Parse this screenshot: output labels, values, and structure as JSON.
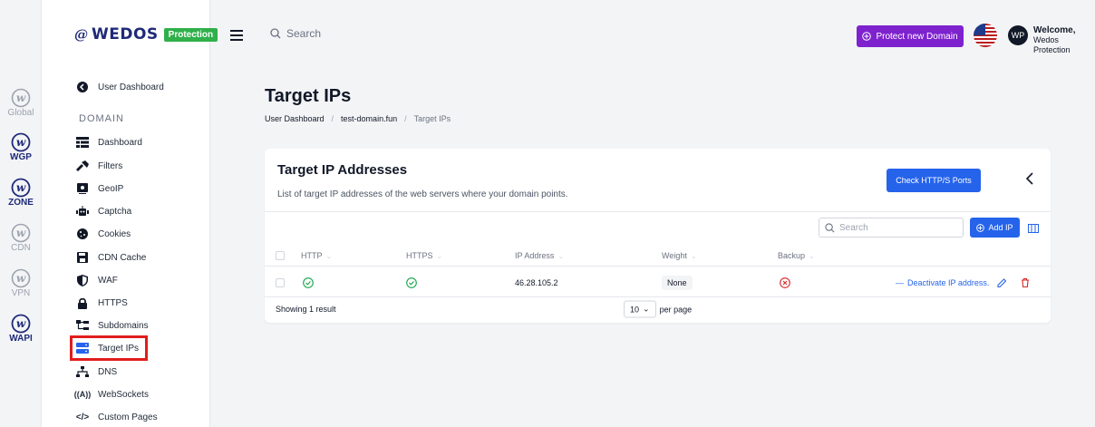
{
  "brand": {
    "mark": "@",
    "name": "WEDOS",
    "badge": "Protection"
  },
  "rail": [
    {
      "label": "Global",
      "state": "muted"
    },
    {
      "label": "WGP",
      "state": "active"
    },
    {
      "label": "ZONE",
      "state": "active"
    },
    {
      "label": "CDN",
      "state": "muted"
    },
    {
      "label": "VPN",
      "state": "muted"
    },
    {
      "label": "WAPI",
      "state": "active"
    }
  ],
  "sidebar": {
    "user_dashboard": "User Dashboard",
    "section": "Domain",
    "items": [
      {
        "label": "Dashboard",
        "icon": "dashboard-icon"
      },
      {
        "label": "Filters",
        "icon": "filter-icon"
      },
      {
        "label": "GeoIP",
        "icon": "geoip-icon"
      },
      {
        "label": "Captcha",
        "icon": "robot-icon"
      },
      {
        "label": "Cookies",
        "icon": "cookie-icon"
      },
      {
        "label": "CDN Cache",
        "icon": "save-icon"
      },
      {
        "label": "WAF",
        "icon": "shield-icon"
      },
      {
        "label": "HTTPS",
        "icon": "lock-icon"
      },
      {
        "label": "Subdomains",
        "icon": "subdomains-icon"
      },
      {
        "label": "Target IPs",
        "icon": "server-icon"
      },
      {
        "label": "DNS",
        "icon": "network-icon"
      },
      {
        "label": "WebSockets",
        "icon": "broadcast-icon"
      },
      {
        "label": "Custom Pages",
        "icon": "code-icon"
      }
    ]
  },
  "topbar": {
    "search_placeholder": "Search",
    "protect_label": "Protect new Domain",
    "avatar_initials": "WP",
    "welcome_line1": "Welcome,",
    "welcome_line2": "Wedos Protection"
  },
  "page": {
    "title": "Target IPs",
    "breadcrumb": [
      "User Dashboard",
      "test-domain.fun",
      "Target IPs"
    ]
  },
  "card": {
    "title": "Target IP Addresses",
    "subtitle": "List of target IP addresses of the web servers where your domain points.",
    "check_ports_label": "Check HTTP/S Ports",
    "search_placeholder": "Search",
    "add_ip_label": "Add IP",
    "columns": [
      "HTTP",
      "HTTPS",
      "IP Address",
      "Weight",
      "Backup"
    ],
    "rows": [
      {
        "http": true,
        "https": true,
        "ip": "46.28.105.2",
        "weight": "None",
        "backup": false,
        "action": "Deactivate IP address."
      }
    ],
    "footer_count": "Showing 1 result",
    "per_page_value": "10",
    "per_page_label": "per page"
  },
  "colors": {
    "brand": "#1e2a78",
    "accent": "#2563eb",
    "protect": "#7e22ce",
    "success": "#16a34a",
    "danger": "#dc2626"
  }
}
